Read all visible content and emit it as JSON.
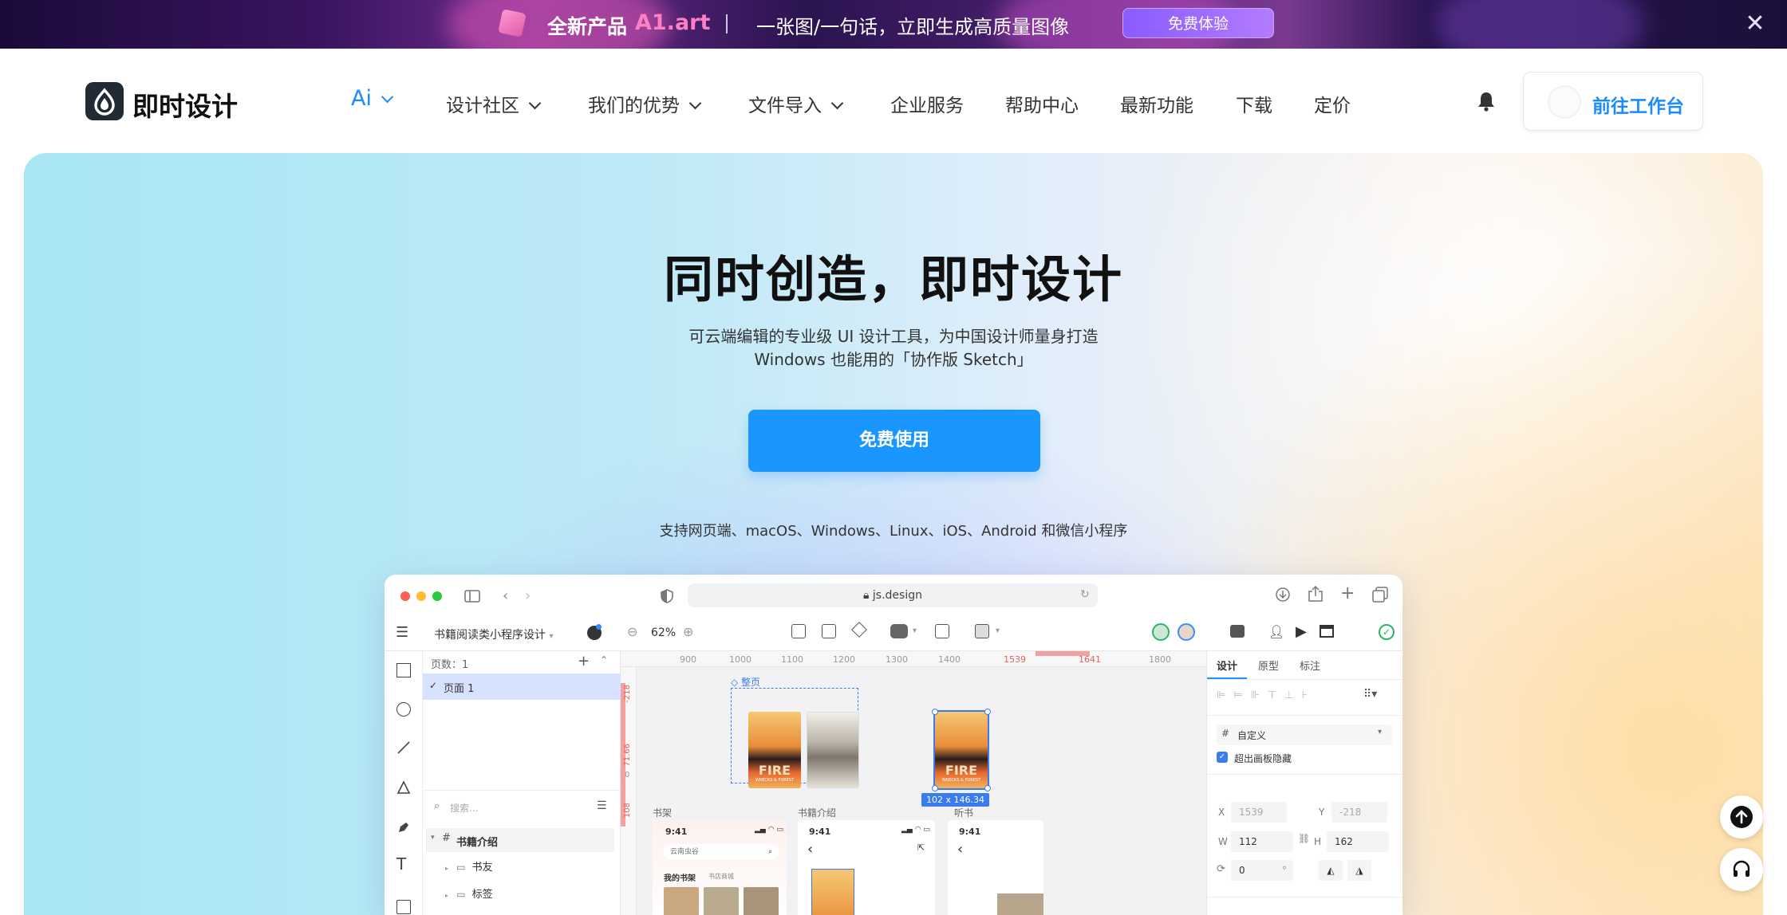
{
  "banner": {
    "tag": "全新产品",
    "product": "A1.art",
    "slogan": "一张图/一句话，立即生成高质量图像",
    "cta": "免费体验",
    "close_icon": "close-icon"
  },
  "nav": {
    "brand": "即时设计",
    "items": [
      {
        "label": "Ai",
        "has_menu": true
      },
      {
        "label": "设计社区",
        "has_menu": true
      },
      {
        "label": "我们的优势",
        "has_menu": true
      },
      {
        "label": "文件导入",
        "has_menu": true
      },
      {
        "label": "企业服务",
        "has_menu": false
      },
      {
        "label": "帮助中心",
        "has_menu": false
      },
      {
        "label": "最新功能",
        "has_menu": false
      },
      {
        "label": "下载",
        "has_menu": false
      },
      {
        "label": "定价",
        "has_menu": false
      }
    ],
    "workbench": "前往工作台"
  },
  "hero": {
    "title": "同时创造，即时设计",
    "subtitle_line1": "可云端编辑的专业级 UI 设计工具，为中国设计师量身打造",
    "subtitle_line2": "Windows 也能用的「协作版 Sketch」",
    "cta": "免费使用",
    "platforms": "支持网页端、macOS、Windows、Linux、iOS、Android 和微信小程序"
  },
  "app": {
    "url": "js.design",
    "file_name": "书籍阅读类小程序设计",
    "zoom": "62%",
    "pages_label": "页数：1",
    "page_item": "页面 1",
    "search_placeholder": "搜索...",
    "layer_root": "书籍介绍",
    "layer_children": [
      "书友",
      "标签"
    ],
    "ruler": [
      "900",
      "1000",
      "1100",
      "1200",
      "1300",
      "1400",
      "1539",
      "1641",
      "1800"
    ],
    "vruler": [
      "-218",
      "71.66",
      "0",
      "108"
    ],
    "frame_label": "整页",
    "selection_size": "102 x 146.34",
    "artboards": [
      "书架",
      "书籍介绍",
      "听书"
    ],
    "phone_time": "9:41",
    "search_text": "云南虫谷",
    "shelf_tab_active": "我的书架",
    "shelf_tab": "书店商城",
    "fire_title": "FIRE",
    "fire_sub": "WRECKS & FOREST",
    "props_tabs": [
      "设计",
      "原型",
      "标注"
    ],
    "frame_preset": "自定义",
    "clip_label": "超出画板隐藏",
    "x_label": "X",
    "x_val": "1539",
    "y_label": "Y",
    "y_val": "-218",
    "w_label": "W",
    "w_val": "112",
    "h_label": "H",
    "h_val": "162",
    "rotation": "0",
    "degree": "°"
  },
  "colors": {
    "accent": "#1a96ff",
    "brand_dark": "#222a36",
    "selection": "#3a7cf0",
    "ruler_highlight": "#f08a8a"
  }
}
